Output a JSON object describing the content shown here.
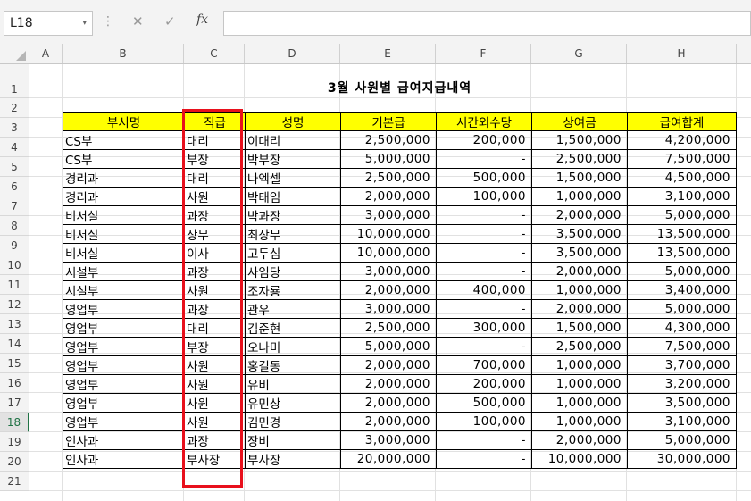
{
  "namebox": {
    "value": "L18"
  },
  "formula_bar": {
    "value": ""
  },
  "columns": [
    "A",
    "B",
    "C",
    "D",
    "E",
    "F",
    "G",
    "H"
  ],
  "rows": [
    "1",
    "2",
    "3",
    "4",
    "5",
    "6",
    "7",
    "8",
    "9",
    "10",
    "11",
    "12",
    "13",
    "14",
    "15",
    "16",
    "17",
    "18",
    "19",
    "20",
    "21"
  ],
  "sheet": {
    "title": "3월 사원별 급여지급내역",
    "headers": [
      "부서명",
      "직급",
      "성명",
      "기본급",
      "시간외수당",
      "상여금",
      "급여합계"
    ],
    "data": [
      [
        "CS부",
        "대리",
        "이대리",
        "2,500,000",
        "200,000",
        "1,500,000",
        "4,200,000"
      ],
      [
        "CS부",
        "부장",
        "박부장",
        "5,000,000",
        "-",
        "2,500,000",
        "7,500,000"
      ],
      [
        "경리과",
        "대리",
        "나엑셀",
        "2,500,000",
        "500,000",
        "1,500,000",
        "4,500,000"
      ],
      [
        "경리과",
        "사원",
        "박태임",
        "2,000,000",
        "100,000",
        "1,000,000",
        "3,100,000"
      ],
      [
        "비서실",
        "과장",
        "박과장",
        "3,000,000",
        "-",
        "2,000,000",
        "5,000,000"
      ],
      [
        "비서실",
        "상무",
        "최상무",
        "10,000,000",
        "-",
        "3,500,000",
        "13,500,000"
      ],
      [
        "비서실",
        "이사",
        "고두심",
        "10,000,000",
        "-",
        "3,500,000",
        "13,500,000"
      ],
      [
        "시설부",
        "과장",
        "사임당",
        "3,000,000",
        "-",
        "2,000,000",
        "5,000,000"
      ],
      [
        "시설부",
        "사원",
        "조자룡",
        "2,000,000",
        "400,000",
        "1,000,000",
        "3,400,000"
      ],
      [
        "영업부",
        "과장",
        "관우",
        "3,000,000",
        "-",
        "2,000,000",
        "5,000,000"
      ],
      [
        "영업부",
        "대리",
        "김준현",
        "2,500,000",
        "300,000",
        "1,500,000",
        "4,300,000"
      ],
      [
        "영업부",
        "부장",
        "오나미",
        "5,000,000",
        "-",
        "2,500,000",
        "7,500,000"
      ],
      [
        "영업부",
        "사원",
        "홍길동",
        "2,000,000",
        "700,000",
        "1,000,000",
        "3,700,000"
      ],
      [
        "영업부",
        "사원",
        "유비",
        "2,000,000",
        "200,000",
        "1,000,000",
        "3,200,000"
      ],
      [
        "영업부",
        "사원",
        "유민상",
        "2,000,000",
        "500,000",
        "1,000,000",
        "3,500,000"
      ],
      [
        "영업부",
        "사원",
        "김민경",
        "2,000,000",
        "100,000",
        "1,000,000",
        "3,100,000"
      ],
      [
        "인사과",
        "과장",
        "장비",
        "3,000,000",
        "-",
        "2,000,000",
        "5,000,000"
      ],
      [
        "인사과",
        "부사장",
        "부사장",
        "20,000,000",
        "-",
        "10,000,000",
        "30,000,000"
      ]
    ]
  },
  "colors": {
    "header_fill": "#ffff00",
    "highlight_border": "#e8101c",
    "selected_row_header": "#217346"
  },
  "icons": {
    "cancel": "✕",
    "enter": "✓",
    "fx": "fx",
    "dropdown": "▾",
    "more": "⋮"
  }
}
